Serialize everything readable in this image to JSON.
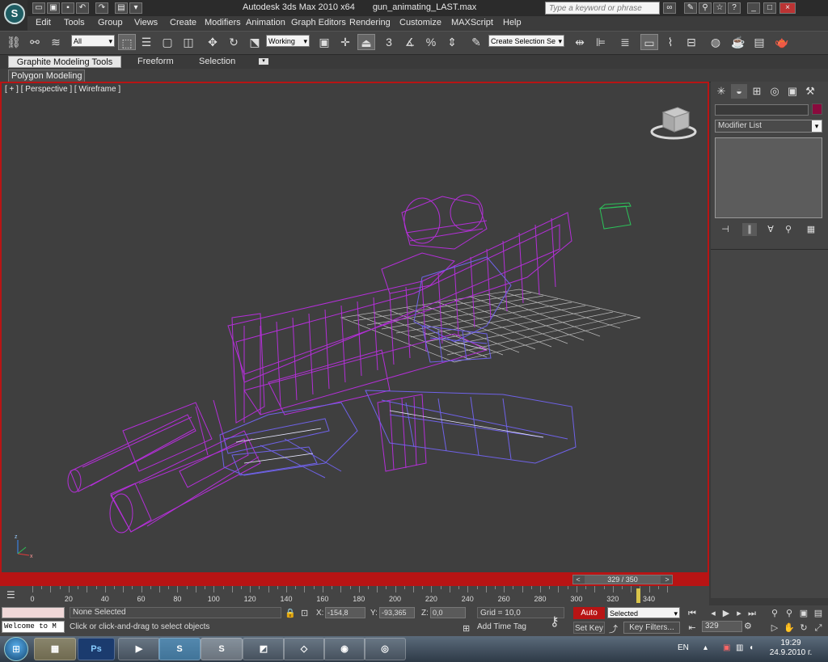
{
  "window": {
    "app_title": "Autodesk 3ds Max  2010 x64",
    "file_name": "gun_animating_LAST.max",
    "search_placeholder": "Type a keyword or phrase"
  },
  "menu": [
    "Edit",
    "Tools",
    "Group",
    "Views",
    "Create",
    "Modifiers",
    "Animation",
    "Graph Editors",
    "Rendering",
    "Customize",
    "MAXScript",
    "Help"
  ],
  "toolbar": {
    "selection_filter": "All",
    "reference_coord": "Working",
    "named_selection": "Create Selection Se",
    "snap_label": "3"
  },
  "ribbon": {
    "tabs": [
      "Graphite Modeling Tools",
      "Freeform",
      "Selection"
    ],
    "panel": "Polygon Modeling"
  },
  "viewport": {
    "label": "[ + ] [ Perspective ] [ Wireframe ]",
    "wire_color": "#b42fd8",
    "hand_color": "#6f62e8",
    "grid_color": "#b9b9b9"
  },
  "command_panel": {
    "modifier_list": "Modifier List",
    "object_color": "#8a0a3d"
  },
  "time_slider": {
    "current": "329 / 350",
    "ticks": [
      "0",
      "20",
      "40",
      "60",
      "80",
      "100",
      "120",
      "140",
      "160",
      "180",
      "200",
      "220",
      "240",
      "260",
      "280",
      "300",
      "320",
      "340"
    ]
  },
  "status": {
    "maxscript_text": "Welcome to M",
    "selection": "None Selected",
    "prompt": "Click or click-and-drag to select objects",
    "x_label": "X:",
    "x_value": "-154,8",
    "y_label": "Y:",
    "y_value": "-93,365",
    "z_label": "Z:",
    "z_value": "0,0",
    "grid": "Grid = 10,0",
    "add_time_tag": "Add Time Tag",
    "auto_key": "Auto Key",
    "set_key": "Set Key",
    "key_mode": "Selected",
    "key_filters": "Key Filters...",
    "frame": "329"
  },
  "taskbar": {
    "language": "EN",
    "time": "19:29",
    "date": "24.9.2010 г."
  }
}
